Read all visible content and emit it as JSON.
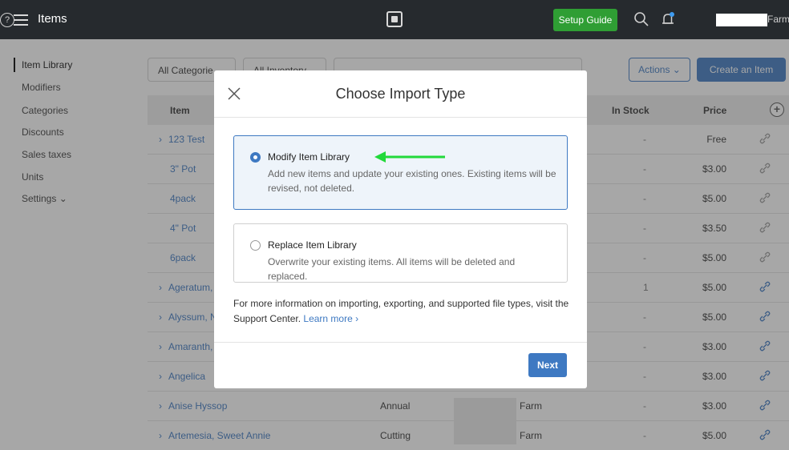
{
  "topbar": {
    "title": "Items",
    "setup_guide": "Setup Guide",
    "user_suffix": "Farm"
  },
  "sidebar": {
    "items": [
      {
        "label": "Item Library"
      },
      {
        "label": "Modifiers"
      },
      {
        "label": "Categories"
      },
      {
        "label": "Discounts"
      },
      {
        "label": "Sales taxes"
      },
      {
        "label": "Units"
      },
      {
        "label": "Settings ⌄"
      }
    ]
  },
  "filters": {
    "categories": "All Categorie",
    "inventory": "All Inventory"
  },
  "toolbar": {
    "actions": "Actions ⌄",
    "create": "Create an Item"
  },
  "table": {
    "headers": {
      "item": "Item",
      "in_stock": "In Stock",
      "price": "Price"
    },
    "rows": [
      {
        "chevron": "›",
        "name": "123 Test",
        "stock": "-",
        "price": "Free"
      },
      {
        "chevron": "",
        "name": "3\" Pot",
        "stock": "-",
        "price": "$3.00"
      },
      {
        "chevron": "",
        "name": "4pack",
        "stock": "-",
        "price": "$5.00"
      },
      {
        "chevron": "",
        "name": "4\" Pot",
        "stock": "-",
        "price": "$3.50"
      },
      {
        "chevron": "",
        "name": "6pack",
        "stock": "-",
        "price": "$5.00"
      },
      {
        "chevron": "›",
        "name": "Ageratum,",
        "stock": "1",
        "price": "$5.00"
      },
      {
        "chevron": "›",
        "name": "Alyssum, N",
        "stock": "-",
        "price": "$5.00"
      },
      {
        "chevron": "›",
        "name": "Amaranth,",
        "stock": "-",
        "price": "$3.00"
      },
      {
        "chevron": "›",
        "name": "Angelica",
        "stock": "-",
        "price": "$3.00"
      },
      {
        "chevron": "›",
        "name": "Anise Hyssop",
        "category": "Annual",
        "location": "Farm",
        "stock": "-",
        "price": "$3.00"
      },
      {
        "chevron": "›",
        "name": "Artemesia, Sweet Annie",
        "category": "Cutting",
        "location": "Farm",
        "stock": "-",
        "price": "$5.00"
      }
    ]
  },
  "modal": {
    "title": "Choose Import Type",
    "option1": {
      "title": "Modify Item Library",
      "desc": "Add new items and update your existing ones. Existing items will be revised, not deleted."
    },
    "option2": {
      "title": "Replace Item Library",
      "desc": "Overwrite your existing items. All items will be deleted and replaced."
    },
    "info": "For more information on importing, exporting, and supported file types, visit the Support Center.",
    "learn_more": "Learn more ›",
    "next": "Next"
  },
  "colors": {
    "accent": "#3e79c2",
    "setup_green": "#2f9e34",
    "arrow_green": "#22d93a",
    "topbar": "#262a2e"
  }
}
